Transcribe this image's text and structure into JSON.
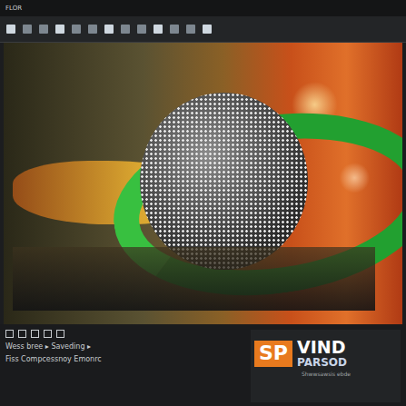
{
  "window": {
    "title": "FLOR"
  },
  "preview": {
    "kind": "video-frame"
  },
  "status_lines": [
    "Wess bree ▸ Saveding ▸",
    "Fiss Compcessnoy Emonrc"
  ],
  "logo": {
    "mark": "SP",
    "name": "VIND",
    "subtitle": "PARSOD",
    "tagline": "Shwwsawsis ebde"
  }
}
